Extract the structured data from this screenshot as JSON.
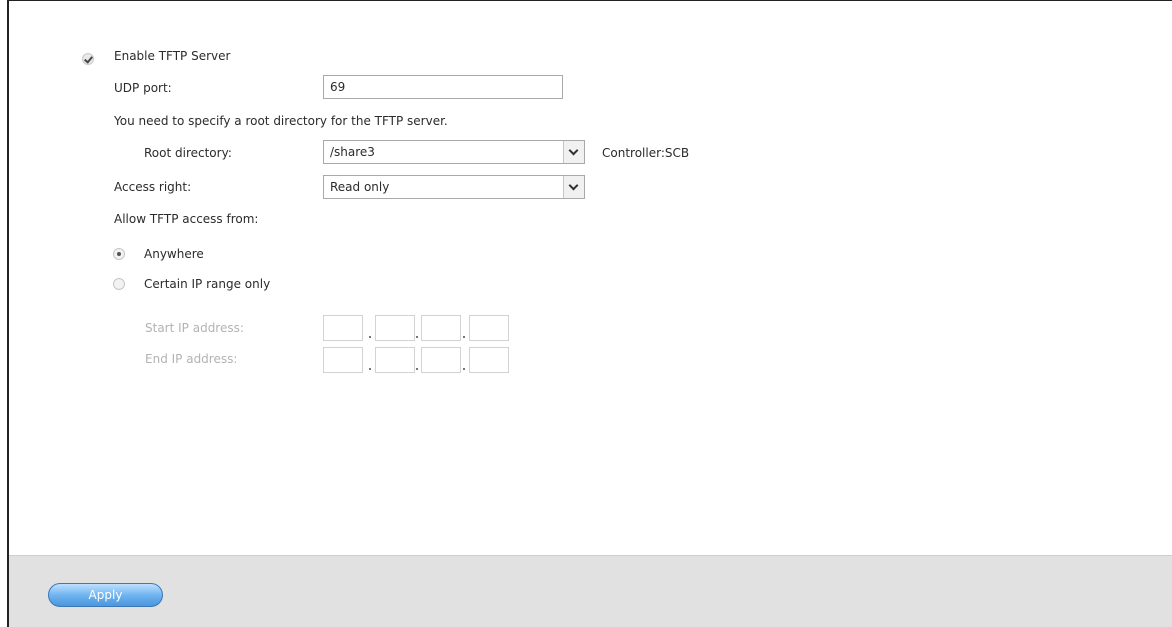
{
  "tftp": {
    "enable_label": "Enable TFTP Server",
    "udp_port_label": "UDP port:",
    "udp_port_value": "69",
    "root_hint": "You need to specify a root directory for the TFTP server.",
    "root_dir_label": "Root directory:",
    "root_dir_value": "/share3",
    "controller_label": "Controller:SCB",
    "access_right_label": "Access right:",
    "access_right_value": "Read only",
    "allow_from_label": "Allow TFTP access from:",
    "option_anywhere": "Anywhere",
    "option_ip_range": "Certain IP range only",
    "start_ip_label": "Start IP address:",
    "end_ip_label": "End IP address:",
    "start_ip": [
      "",
      "",
      "",
      ""
    ],
    "end_ip": [
      "",
      "",
      "",
      ""
    ]
  },
  "footer": {
    "apply_label": "Apply"
  },
  "icons": {
    "enable_checkbox": "checkmark-icon",
    "dropdown_arrow": "chevron-down-icon"
  }
}
